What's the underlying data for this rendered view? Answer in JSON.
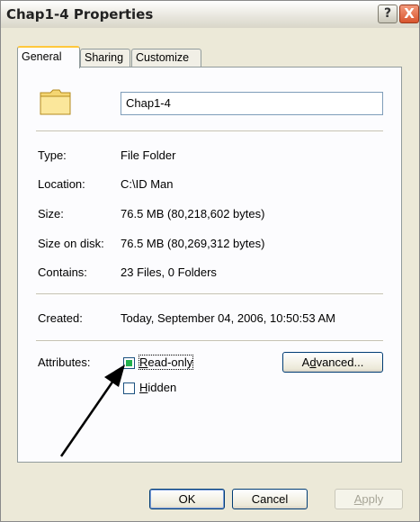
{
  "window": {
    "title": "Chap1-4 Properties"
  },
  "titlebar": {
    "help_label": "?",
    "close_label": "X"
  },
  "tabs": [
    {
      "label": "General",
      "active": true
    },
    {
      "label": "Sharing",
      "active": false
    },
    {
      "label": "Customize",
      "active": false
    }
  ],
  "general": {
    "name_value": "Chap1-4",
    "rows": [
      {
        "label": "Type:",
        "value": "File Folder"
      },
      {
        "label": "Location:",
        "value": "C:\\ID Man"
      },
      {
        "label": "Size:",
        "value": "76.5 MB (80,218,602 bytes)"
      },
      {
        "label": "Size on disk:",
        "value": "76.5 MB (80,269,312 bytes)"
      },
      {
        "label": "Contains:",
        "value": "23 Files, 0 Folders"
      }
    ],
    "created": {
      "label": "Created:",
      "value": "Today, September 04, 2006, 10:50:53 AM"
    },
    "attributes": {
      "label": "Attributes:",
      "readonly": {
        "label_mnemonic": "R",
        "label_rest": "ead-only",
        "state": "mixed"
      },
      "hidden": {
        "label_mnemonic": "H",
        "label_rest": "idden",
        "state": "unchecked"
      },
      "advanced": {
        "label_pre": "A",
        "label_mnemonic": "d",
        "label_rest": "vanced..."
      }
    }
  },
  "footer": {
    "ok_label": "OK",
    "cancel_label": "Cancel",
    "apply_mnemonic": "A",
    "apply_rest": "pply"
  },
  "colors": {
    "checkbox_fill": "#22b14c",
    "tab_highlight": "#ffc83c"
  },
  "icons": {
    "folder": "folder-icon",
    "arrow": "annotation-arrow"
  }
}
